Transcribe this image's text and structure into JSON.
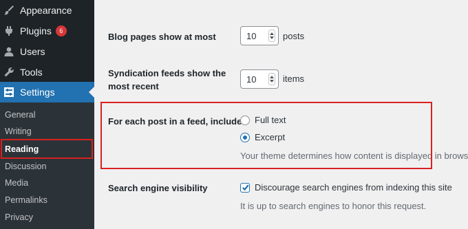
{
  "sidebar": {
    "menu": [
      {
        "label": "Appearance",
        "icon": "paintbrush-icon"
      },
      {
        "label": "Plugins",
        "icon": "plugin-icon",
        "badge": "6"
      },
      {
        "label": "Users",
        "icon": "users-icon"
      },
      {
        "label": "Tools",
        "icon": "wrench-icon"
      },
      {
        "label": "Settings",
        "icon": "settings-icon",
        "current": true
      }
    ],
    "submenu": [
      {
        "label": "General"
      },
      {
        "label": "Writing"
      },
      {
        "label": "Reading",
        "active": true
      },
      {
        "label": "Discussion"
      },
      {
        "label": "Media"
      },
      {
        "label": "Permalinks"
      },
      {
        "label": "Privacy"
      }
    ]
  },
  "settings": {
    "blog_pages": {
      "label": "Blog pages show at most",
      "value": "10",
      "unit": "posts"
    },
    "syndication": {
      "label_line1": "Syndication feeds show the",
      "label_line2": "most recent",
      "value": "10",
      "unit": "items"
    },
    "feed_include": {
      "label": "For each post in a feed, include",
      "options": [
        {
          "label": "Full text",
          "checked": false
        },
        {
          "label": "Excerpt",
          "checked": true
        }
      ],
      "description": "Your theme determines how content is displayed in browsers."
    },
    "search_visibility": {
      "label": "Search engine visibility",
      "checkbox_label": "Discourage search engines from indexing this site",
      "checked": true,
      "description": "It is up to search engines to honor this request."
    }
  },
  "colors": {
    "accent": "#2271b1",
    "highlight": "#d92020",
    "sidebar": "#1d2327",
    "badge": "#d63638"
  }
}
